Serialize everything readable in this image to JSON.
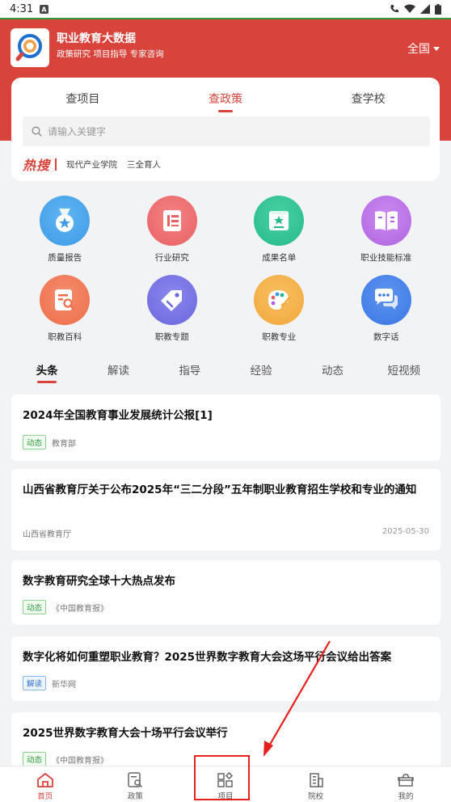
{
  "status": {
    "time": "4:31"
  },
  "header": {
    "title": "职业教育大数据",
    "subtitle": "政策研究 项目指导 专家咨询",
    "region": "全国"
  },
  "search_tabs": [
    {
      "label": "查项目"
    },
    {
      "label": "查政策"
    },
    {
      "label": "查学校"
    }
  ],
  "search": {
    "placeholder": "请输入关键字"
  },
  "hot": {
    "label": "热搜",
    "items": [
      "现代产业学院",
      "三全育人"
    ]
  },
  "grid": [
    {
      "label": "质量报告",
      "icon": "medal-icon",
      "color": "#3e9be6"
    },
    {
      "label": "行业研究",
      "icon": "document-list-icon",
      "color": "#ea6163"
    },
    {
      "label": "成果名单",
      "icon": "star-certificate-icon",
      "color": "#24b98a"
    },
    {
      "label": "职业技能标准",
      "icon": "book-icon",
      "color": "#b063e0"
    },
    {
      "label": "职教百科",
      "icon": "document-search-icon",
      "color": "#ee6e49"
    },
    {
      "label": "职教专题",
      "icon": "tag-icon",
      "color": "#6b67e0"
    },
    {
      "label": "职教专业",
      "icon": "palette-icon",
      "color": "#f2a73a"
    },
    {
      "label": "数字话",
      "icon": "chat-bubbles-icon",
      "color": "#3977e6"
    }
  ],
  "news_tabs": [
    "头条",
    "解读",
    "指导",
    "经验",
    "动态",
    "短视频"
  ],
  "news": [
    {
      "title": "2024年全国教育事业发展统计公报[1]",
      "tag": "动态",
      "source": "教育部",
      "date": ""
    },
    {
      "title": "山西省教育厅关于公布2025年“三二分段”五年制职业教育招生学校和专业的通知",
      "tag": "",
      "source": "山西省教育厅",
      "date": "2025-05-30"
    },
    {
      "title": "数字教育研究全球十大热点发布",
      "tag": "动态",
      "source": "《中国教育报》",
      "date": ""
    },
    {
      "title": "数字化将如何重塑职业教育？2025世界数字教育大会这场平行会议给出答案",
      "tag": "解读",
      "source": "新华网",
      "date": ""
    },
    {
      "title": "2025世界数字教育大会十场平行会议举行",
      "tag": "动态",
      "source": "《中国教育报》",
      "date": ""
    }
  ],
  "bottom_nav": [
    {
      "label": "首页"
    },
    {
      "label": "政策"
    },
    {
      "label": "项目"
    },
    {
      "label": "院校"
    },
    {
      "label": "我的"
    }
  ],
  "colors": {
    "brand": "#d8433c",
    "highlight": "#e5201d"
  }
}
